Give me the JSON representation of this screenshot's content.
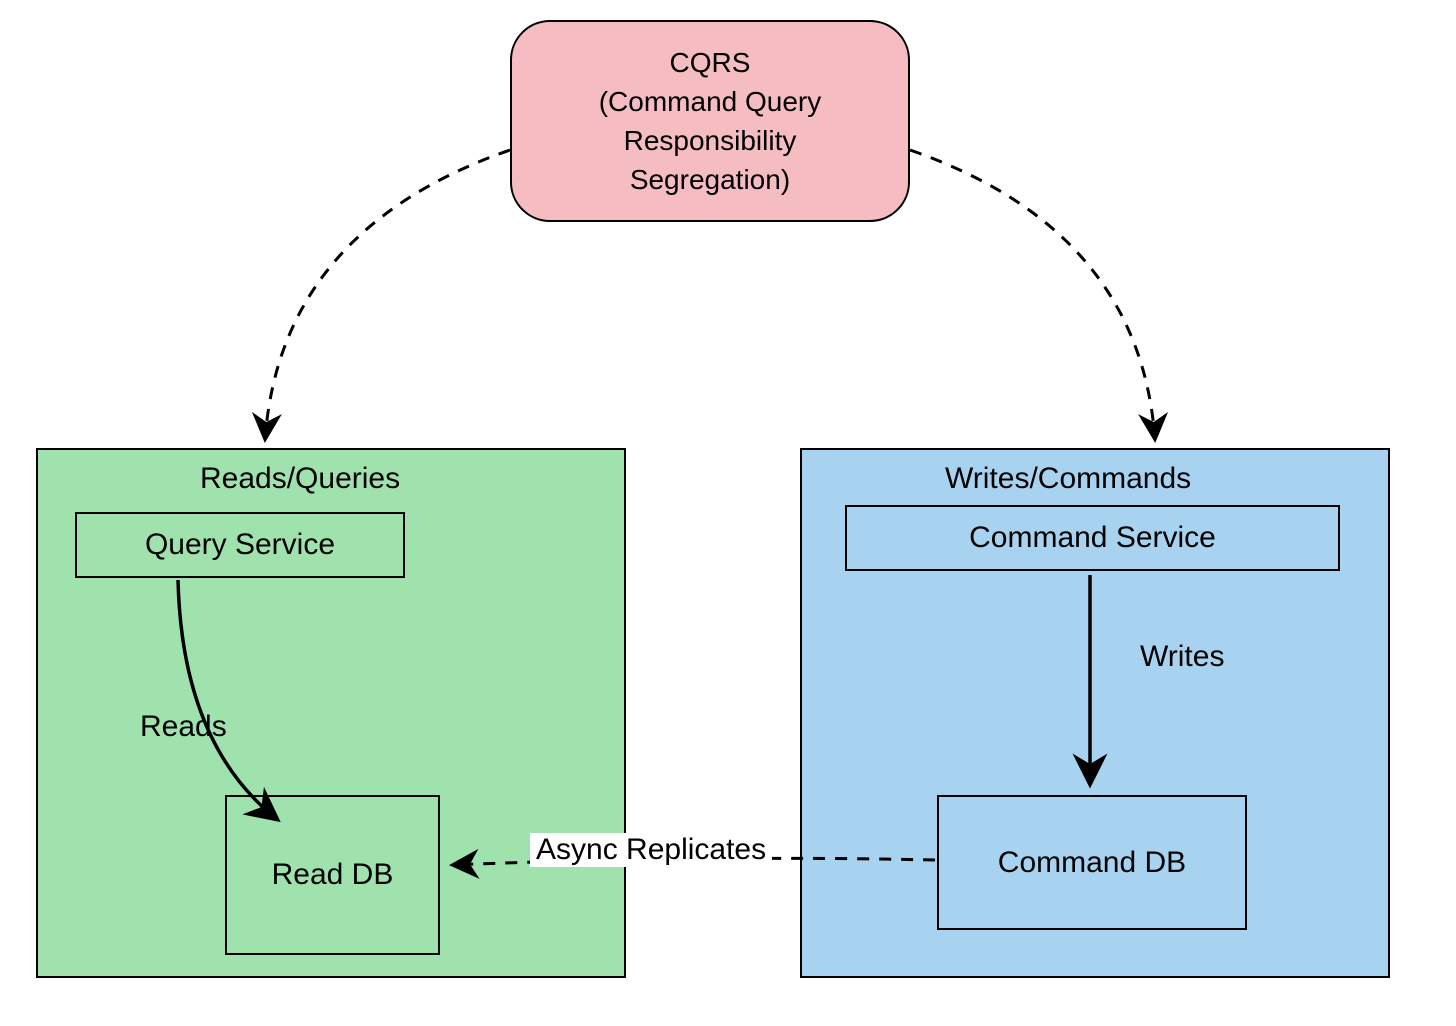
{
  "nodes": {
    "cqrs": {
      "line1": "CQRS",
      "line2": "(Command Query",
      "line3": "Responsibility",
      "line4": "Segregation)"
    },
    "reads_panel_title": "Reads/Queries",
    "writes_panel_title": "Writes/Commands",
    "query_service": "Query Service",
    "command_service": "Command Service",
    "read_db": "Read DB",
    "command_db": "Command DB"
  },
  "edges": {
    "reads_label": "Reads",
    "writes_label": "Writes",
    "replicates_label": "Async Replicates"
  },
  "colors": {
    "cqrs_bg": "#f5bcc2",
    "reads_bg": "#a0e2ae",
    "writes_bg": "#a7d3f0",
    "stroke": "#000000"
  }
}
